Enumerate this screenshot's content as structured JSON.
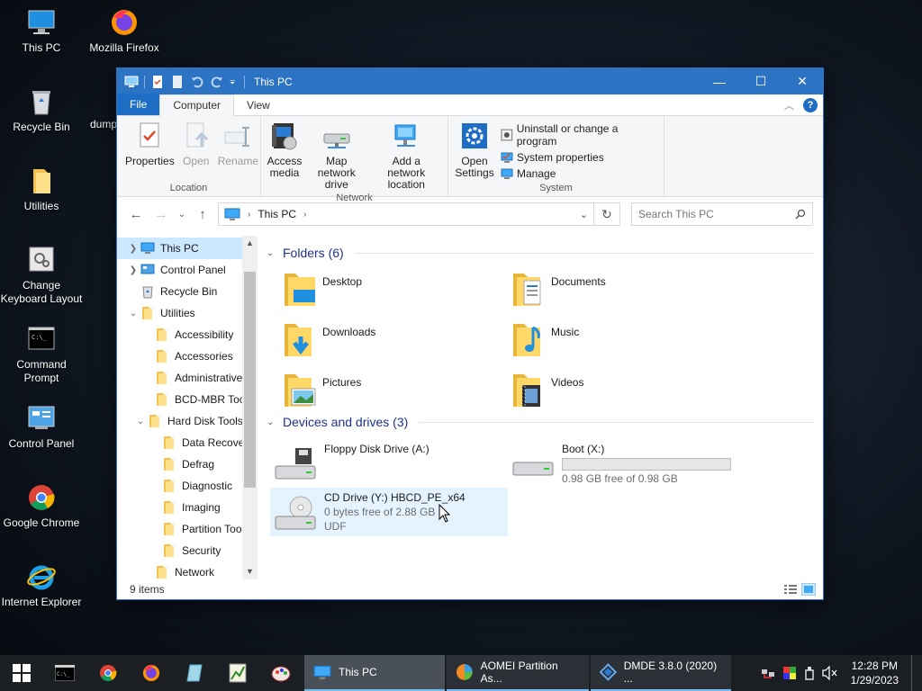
{
  "desktop": {
    "icons": [
      {
        "label": "This PC"
      },
      {
        "label": "Mozilla Firefox"
      },
      {
        "label": "Recycle Bin"
      },
      {
        "label": "dump"
      },
      {
        "label": "Utilities"
      },
      {
        "label": "Change Keyboard Layout"
      },
      {
        "label": "Command Prompt"
      },
      {
        "label": "Control Panel"
      },
      {
        "label": "Google Chrome"
      },
      {
        "label": "Internet Explorer"
      }
    ]
  },
  "window": {
    "title": "This PC",
    "controls": {
      "minimize": "—",
      "maximize": "☐",
      "close": "✕"
    }
  },
  "ribbon": {
    "tabs": [
      "File",
      "Computer",
      "View"
    ],
    "location": {
      "name": "Location",
      "buttons": [
        "Properties",
        "Open",
        "Rename"
      ]
    },
    "network": {
      "name": "Network",
      "access_media": "Access media",
      "map_drive": "Map network drive",
      "add_location": "Add a network location"
    },
    "system": {
      "name": "System",
      "open_settings": "Open Settings",
      "uninstall": "Uninstall or change a program",
      "properties": "System properties",
      "manage": "Manage"
    }
  },
  "address": {
    "crumb": "This PC",
    "search_placeholder": "Search This PC"
  },
  "nav": {
    "items": [
      {
        "label": "This PC"
      },
      {
        "label": "Control Panel"
      },
      {
        "label": "Recycle Bin"
      },
      {
        "label": "Utilities"
      },
      {
        "label": "Accessibility"
      },
      {
        "label": "Accessories"
      },
      {
        "label": "Administrative"
      },
      {
        "label": "BCD-MBR Tool"
      },
      {
        "label": "Hard Disk Tools"
      },
      {
        "label": "Data Recovery"
      },
      {
        "label": "Defrag"
      },
      {
        "label": "Diagnostic"
      },
      {
        "label": "Imaging"
      },
      {
        "label": "Partition Tool"
      },
      {
        "label": "Security"
      },
      {
        "label": "Network"
      }
    ]
  },
  "folders": {
    "header": "Folders (6)",
    "items": [
      {
        "name": "Desktop"
      },
      {
        "name": "Documents"
      },
      {
        "name": "Downloads"
      },
      {
        "name": "Music"
      },
      {
        "name": "Pictures"
      },
      {
        "name": "Videos"
      }
    ]
  },
  "devices": {
    "header": "Devices and drives (3)",
    "floppy": {
      "name": "Floppy Disk Drive (A:)"
    },
    "boot": {
      "name": "Boot (X:)",
      "free": "0.98 GB free of 0.98 GB",
      "used_fraction": 0.0
    },
    "cd": {
      "name": "CD Drive (Y:) HBCD_PE_x64",
      "free": "0 bytes free of 2.88 GB",
      "fs": "UDF"
    }
  },
  "status": {
    "items": "9 items"
  },
  "taskbar": {
    "tasks": [
      {
        "label": "This PC"
      },
      {
        "label": "AOMEI Partition As..."
      },
      {
        "label": "DMDE 3.8.0 (2020) ..."
      }
    ],
    "time": "12:28 PM",
    "date": "1/29/2023"
  }
}
